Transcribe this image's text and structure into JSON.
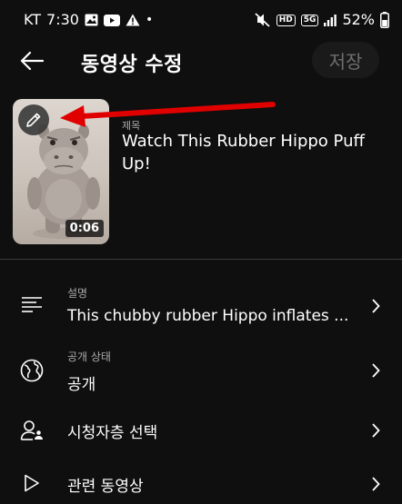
{
  "status_bar": {
    "carrier": "KT",
    "time": "7:30",
    "dot": "•",
    "hd_badge": "HD",
    "fiveg_badge": "5G",
    "battery": "52%",
    "left_icons": [
      "gallery-icon",
      "youtube-icon",
      "warning-icon"
    ],
    "right_icons": [
      "mute-icon",
      "hd-icon",
      "5g-icon",
      "signal-icon",
      "battery-icon"
    ]
  },
  "header": {
    "title": "동영상 수정",
    "save_label": "저장"
  },
  "video": {
    "title_label": "제목",
    "title": "Watch This Rubber Hippo Puff Up!",
    "duration": "0:06"
  },
  "rows": {
    "description": {
      "label": "설명",
      "value": "This chubby rubber Hippo inflates ..."
    },
    "visibility": {
      "label": "공개 상태",
      "value": "공개"
    },
    "audience": {
      "value": "시청자층 선택"
    },
    "related": {
      "value": "관련 동영상"
    }
  },
  "colors": {
    "background": "#0f0f0f",
    "annotation_arrow": "#e00000",
    "save_disabled_text": "#6e6e6e",
    "secondary_text": "#aaaaaa"
  }
}
